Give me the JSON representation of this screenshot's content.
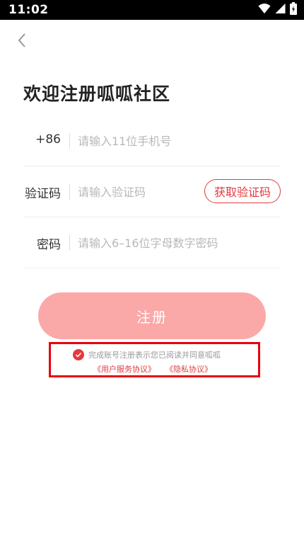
{
  "status_bar": {
    "time": "11:02",
    "icons": [
      "wifi-icon",
      "signal-icon",
      "battery-icon"
    ]
  },
  "nav": {
    "back_icon": "chevron-left-icon"
  },
  "title": "欢迎注册呱呱社区",
  "form": {
    "phone": {
      "label": "+86",
      "placeholder": "请输入11位手机号"
    },
    "code": {
      "label": "验证码",
      "placeholder": "请输入验证码",
      "button": "获取验证码"
    },
    "password": {
      "label": "密码",
      "placeholder": "请输入6–16位字母数字密码"
    }
  },
  "submit_label": "注册",
  "agreement": {
    "text": "完成账号注册表示您已阅读并同意呱呱",
    "user_agreement": "《用户服务协议》",
    "privacy_policy": "《隐私协议》",
    "checked": true
  },
  "colors": {
    "accent": "#e5393e",
    "button_disabled": "#fba8a8",
    "highlight_box": "#e8000b"
  }
}
